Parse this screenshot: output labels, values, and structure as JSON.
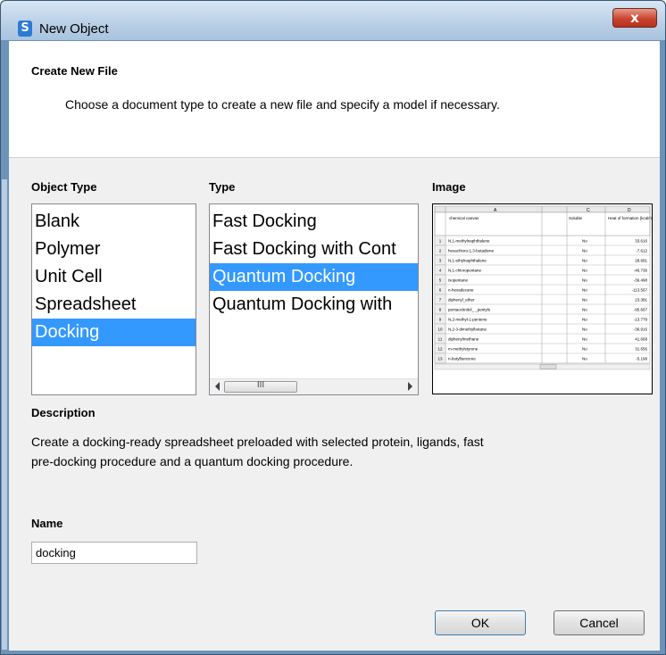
{
  "window": {
    "title": "New Object",
    "close_label": "x"
  },
  "header": {
    "title": "Create New File",
    "subtitle": "Choose a document type to create a new file and specify a model if necessary."
  },
  "object_type": {
    "label": "Object Type",
    "items": [
      "Blank",
      "Polymer",
      "Unit Cell",
      "Spreadsheet",
      "Docking"
    ],
    "selected": "Docking"
  },
  "type": {
    "label": "Type",
    "items": [
      "Fast Docking",
      "Fast Docking with Cont",
      "Quantum Docking",
      "Quantum Docking with"
    ],
    "selected": "Quantum Docking",
    "scroll_thumb": "III"
  },
  "image": {
    "label": "Image",
    "columns": [
      "A",
      "C",
      "D"
    ],
    "headers": [
      "chemical canvas",
      "Soluble",
      "Heat of formation (kcal/mol)"
    ],
    "rows": [
      {
        "n": "1",
        "name": "N,1-methylnaphthalene",
        "sol": "No",
        "heat": "33.616"
      },
      {
        "n": "2",
        "name": "hexachloro-1,3-butadiene",
        "sol": "No",
        "heat": "-7.612"
      },
      {
        "n": "3",
        "name": "N,1-ethylnaphthalene",
        "sol": "No",
        "heat": "28.681"
      },
      {
        "n": "4",
        "name": "N,1-chloropentane",
        "sol": "No",
        "heat": "-46.736"
      },
      {
        "n": "5",
        "name": "isopentane",
        "sol": "No",
        "heat": "-36.498"
      },
      {
        "n": "6",
        "name": "n-hexadecane",
        "sol": "No",
        "heat": "-113.567"
      },
      {
        "n": "7",
        "name": "diphenyl_ether",
        "sol": "No",
        "heat": "23.381"
      },
      {
        "n": "8",
        "name": "pentaoctinitol_ _pentyls",
        "sol": "No",
        "heat": "-95.667"
      },
      {
        "n": "9",
        "name": "N,2-methyl-1-pentene",
        "sol": "No",
        "heat": "-13.778"
      },
      {
        "n": "10",
        "name": "N,2-3-dimethylbutane",
        "sol": "No",
        "heat": "-36.916"
      },
      {
        "n": "11",
        "name": "diphenylmethane",
        "sol": "No",
        "heat": "41.668"
      },
      {
        "n": "12",
        "name": "m-methylstyrene",
        "sol": "No",
        "heat": "31.656"
      },
      {
        "n": "13",
        "name": "n-butylbenzene",
        "sol": "No",
        "heat": "-5.198"
      }
    ]
  },
  "description": {
    "label": "Description",
    "line1": "Create a docking-ready spreadsheet preloaded with selected protein, ligands, fast",
    "line2": "pre-docking procedure and a quantum docking procedure."
  },
  "name": {
    "label": "Name",
    "value": "docking"
  },
  "buttons": {
    "ok": "OK",
    "cancel": "Cancel"
  }
}
